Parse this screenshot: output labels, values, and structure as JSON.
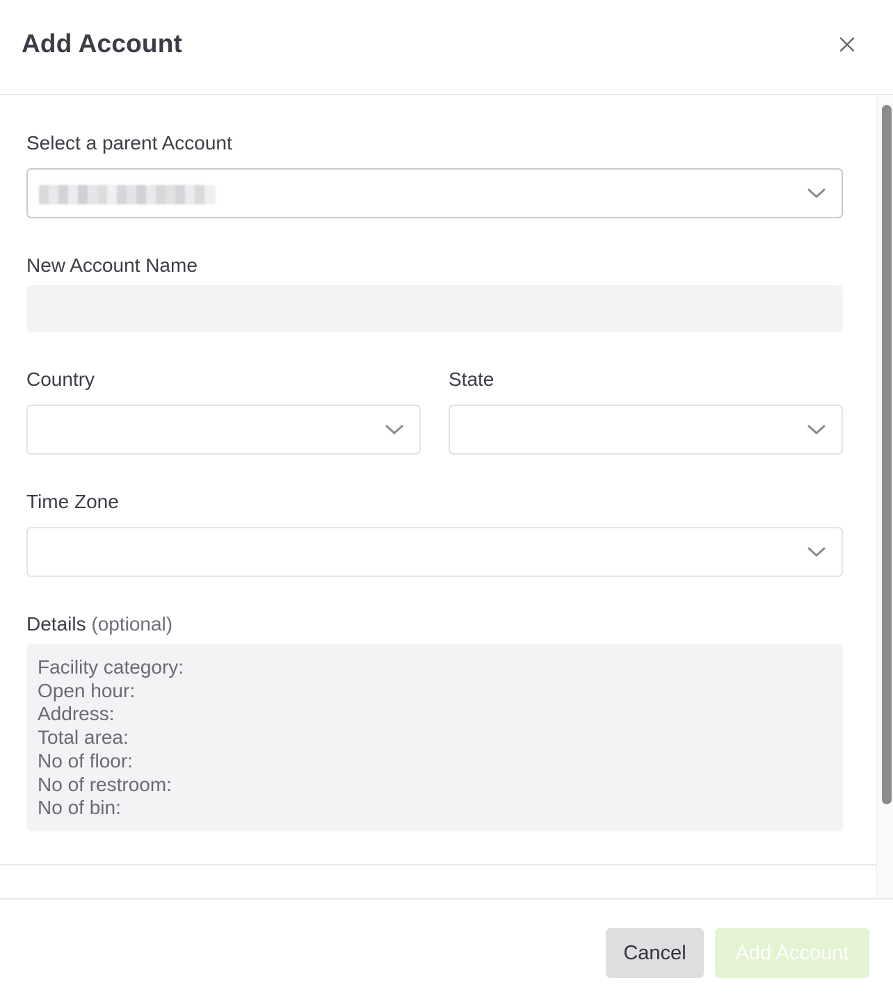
{
  "header": {
    "title": "Add Account",
    "close_icon": "close-icon"
  },
  "form": {
    "parent_account": {
      "label": "Select a parent Account",
      "value": "██████ ██████",
      "value_redacted": true
    },
    "account_name": {
      "label": "New Account Name",
      "value": ""
    },
    "country": {
      "label": "Country",
      "value": ""
    },
    "state": {
      "label": "State",
      "value": ""
    },
    "time_zone": {
      "label": "Time Zone",
      "value": ""
    },
    "details": {
      "label": "Details",
      "label_optional": "(optional)",
      "lines": [
        "Facility category:",
        "Open hour:",
        "Address:",
        "Total area:",
        "No of floor:",
        "No of restroom:",
        "No of bin:"
      ]
    }
  },
  "footer": {
    "cancel_label": "Cancel",
    "submit_label": "Add Account",
    "submit_disabled": true
  },
  "colors": {
    "submit_bg": "#e4f4d1",
    "cancel_bg": "#dedee1",
    "input_bg": "#f3f3f5",
    "border": "#e3e3e8",
    "text": "#3d3d47"
  }
}
